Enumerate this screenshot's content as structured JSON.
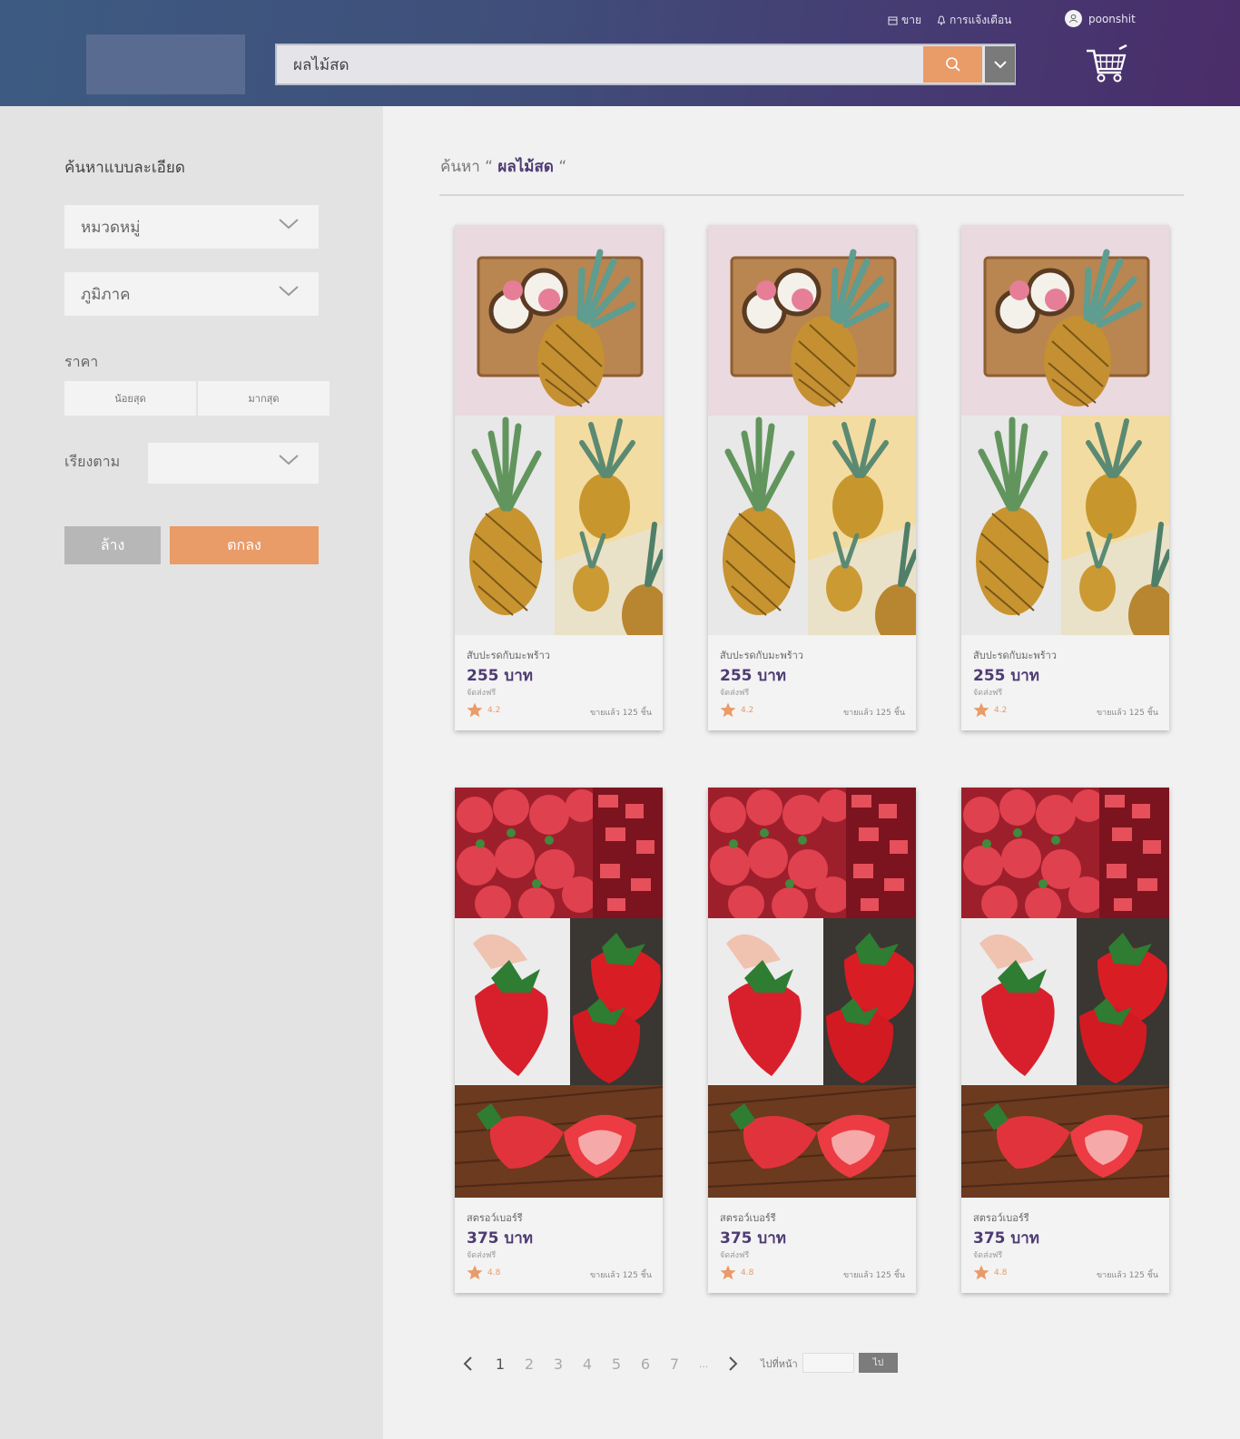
{
  "header": {
    "sell_label": "ขาย",
    "notifications_label": "การแจ้งเตือน",
    "username": "poonshit",
    "search": {
      "value": "ผลไม้สด"
    }
  },
  "sidebar": {
    "title": "ค้นหาแบบละเอียด",
    "category_placeholder": "หมวดหมู่",
    "region_placeholder": "ภูมิภาค",
    "price_label": "ราคา",
    "price_min_placeholder": "น้อยสุด",
    "price_max_placeholder": "มากสุด",
    "sort_label": "เรียงตาม",
    "clear_label": "ล้าง",
    "ok_label": "ตกลง"
  },
  "results": {
    "prefix": "ค้นหา",
    "open_quote": "“",
    "term": "ผลไม้สด",
    "close_quote": "“"
  },
  "products": [
    {
      "name": "สับปะรดกับมะพร้าว",
      "price": "255 บาท",
      "shipping": "จัดส่งฟรี",
      "rating": "4.2",
      "sold": "ขายแล้ว 125 ชิ้น",
      "image": "pineapple"
    },
    {
      "name": "สับปะรดกับมะพร้าว",
      "price": "255 บาท",
      "shipping": "จัดส่งฟรี",
      "rating": "4.2",
      "sold": "ขายแล้ว 125 ชิ้น",
      "image": "pineapple"
    },
    {
      "name": "สับปะรดกับมะพร้าว",
      "price": "255 บาท",
      "shipping": "จัดส่งฟรี",
      "rating": "4.2",
      "sold": "ขายแล้ว 125 ชิ้น",
      "image": "pineapple"
    },
    {
      "name": "สตรอว์เบอร์รี",
      "price": "375 บาท",
      "shipping": "จัดส่งฟรี",
      "rating": "4.8",
      "sold": "ขายแล้ว 125 ชิ้น",
      "image": "strawberry"
    },
    {
      "name": "สตรอว์เบอร์รี",
      "price": "375 บาท",
      "shipping": "จัดส่งฟรี",
      "rating": "4.8",
      "sold": "ขายแล้ว 125 ชิ้น",
      "image": "strawberry"
    },
    {
      "name": "สตรอว์เบอร์รี",
      "price": "375 บาท",
      "shipping": "จัดส่งฟรี",
      "rating": "4.8",
      "sold": "ขายแล้ว 125 ชิ้น",
      "image": "strawberry"
    }
  ],
  "pagination": {
    "pages": [
      "1",
      "2",
      "3",
      "4",
      "5",
      "6",
      "7"
    ],
    "ellipsis": "...",
    "current": "1",
    "goto_label": "ไปที่หน้า",
    "go_button": "ไป"
  },
  "colors": {
    "accent": "#e99b68",
    "brand": "#4e3b73",
    "header_start": "#3d5b82",
    "header_end": "#4a2d6a"
  }
}
